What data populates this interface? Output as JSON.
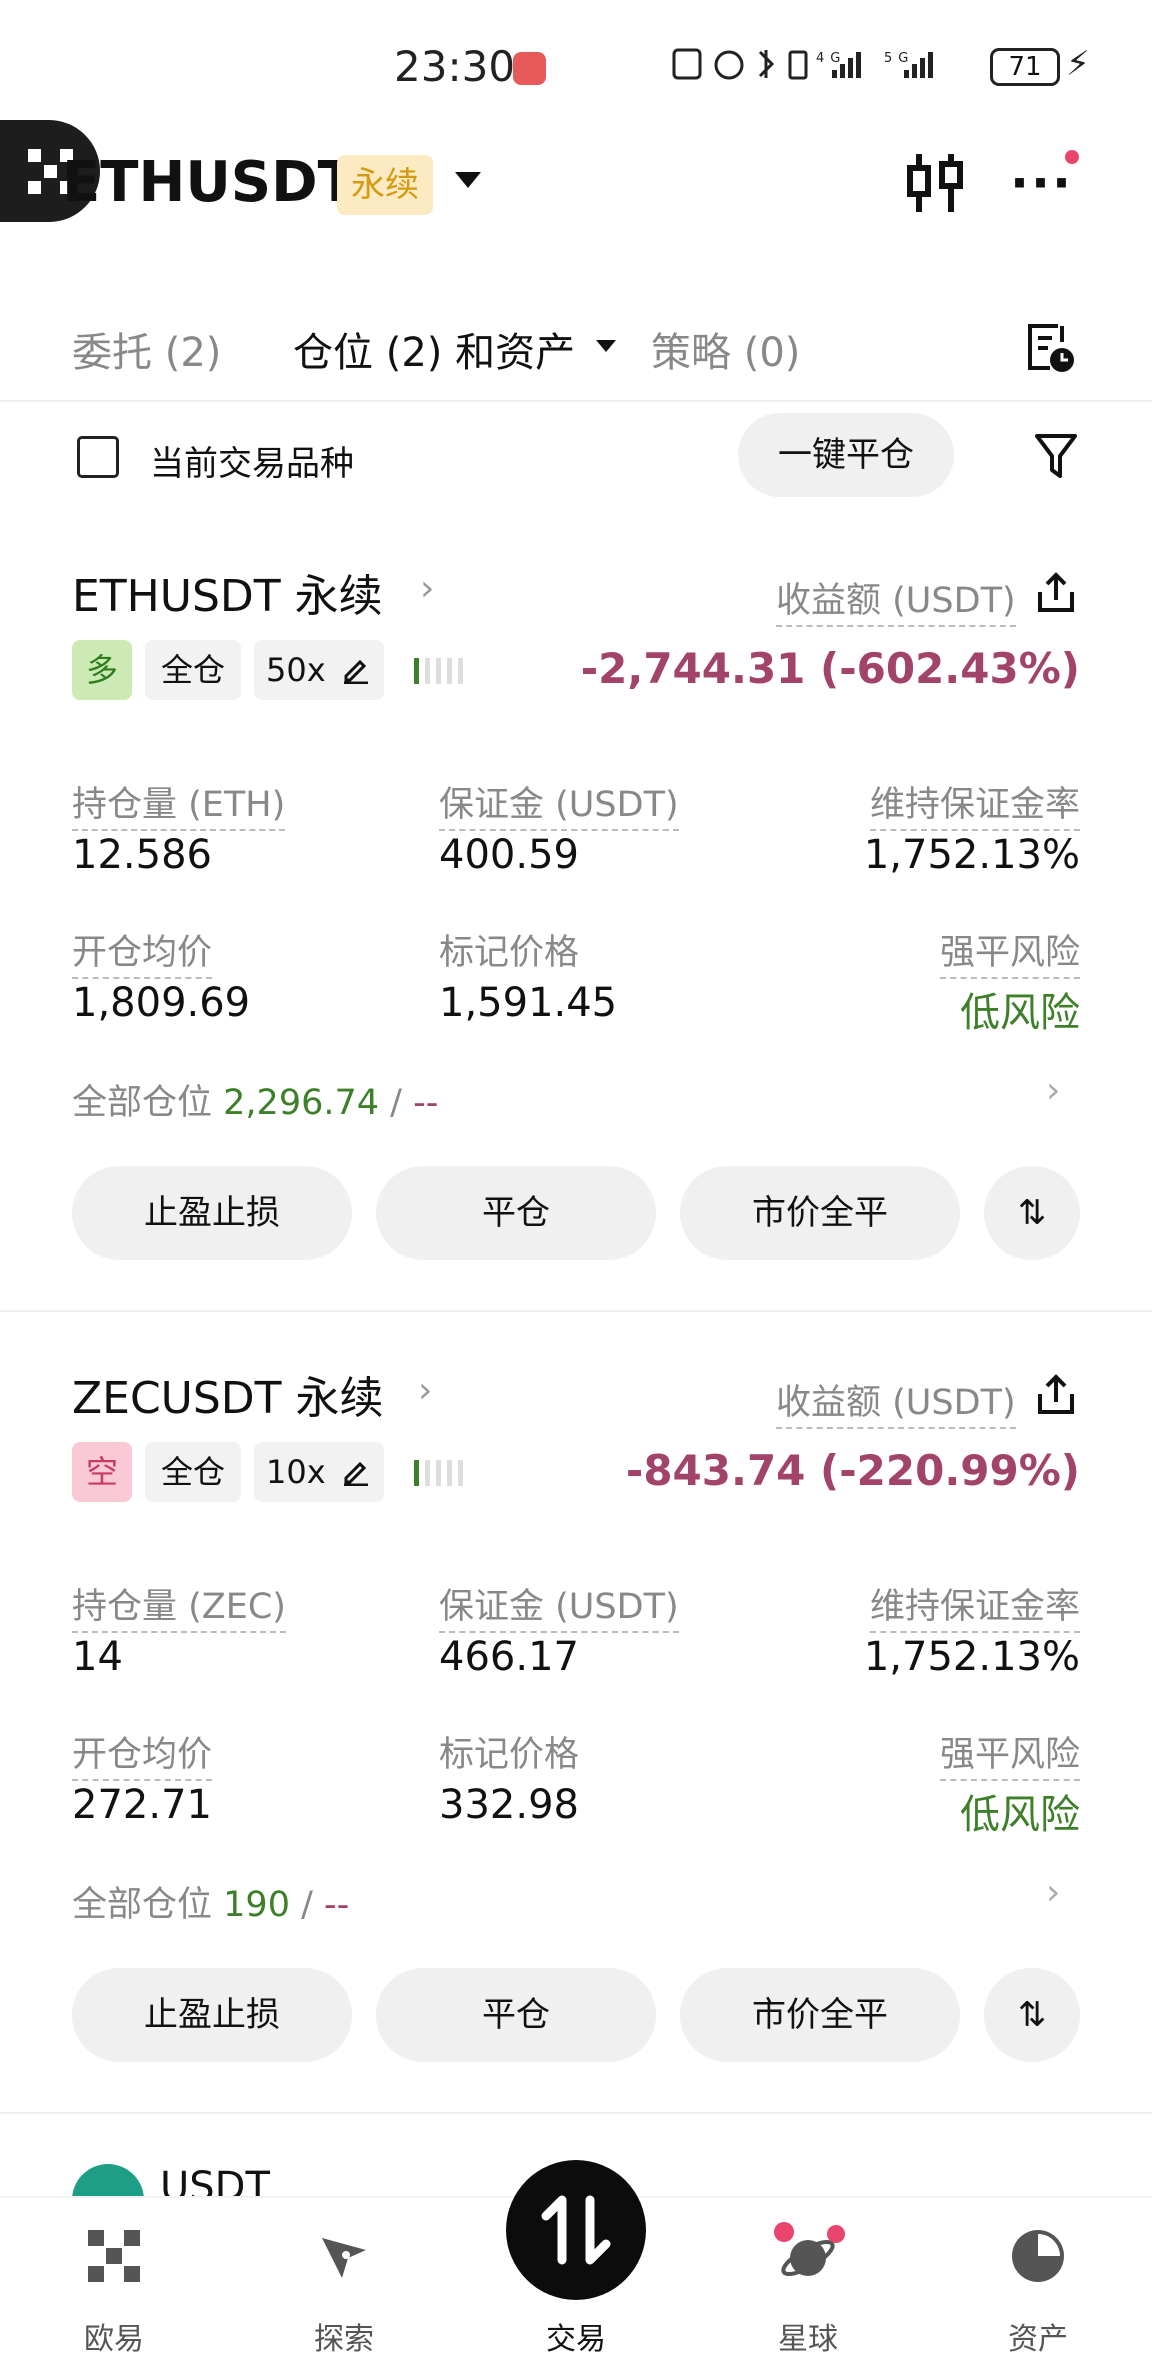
{
  "status_bar": {
    "time": "23:30",
    "battery": "71"
  },
  "header": {
    "pair": "ETHUSDT",
    "contract_type": "永续"
  },
  "tabs": {
    "orders": "委托 (2)",
    "positions": "仓位 (2) 和资产",
    "strategies": "策略 (0)"
  },
  "filter": {
    "current_only_label": "当前交易品种",
    "close_all_label": "一键平仓"
  },
  "positions": [
    {
      "title": "ETHUSDT 永续",
      "side": "多",
      "margin_mode": "全仓",
      "leverage": "50x",
      "pnl_label": "收益额 (USDT)",
      "pnl": "-2,744.31 (-602.43%)",
      "size_label": "持仓量 (ETH)",
      "size": "12.586",
      "margin_label": "保证金 (USDT)",
      "margin": "400.59",
      "mmr_label": "维持保证金率",
      "mmr": "1,752.13%",
      "entry_label": "开仓均价",
      "entry": "1,809.69",
      "mark_label": "标记价格",
      "mark": "1,591.45",
      "risk_label": "强平风险",
      "risk": "低风险",
      "total_label": "全部仓位",
      "total_value": "2,296.74",
      "total_sep": " / ",
      "total_extra": "--",
      "btn_tpsl": "止盈止损",
      "btn_close": "平仓",
      "btn_market_close": "市价全平",
      "btn_reverse": "⇅"
    },
    {
      "title": "ZECUSDT 永续",
      "side": "空",
      "margin_mode": "全仓",
      "leverage": "10x",
      "pnl_label": "收益额 (USDT)",
      "pnl": "-843.74 (-220.99%)",
      "size_label": "持仓量 (ZEC)",
      "size": "14",
      "margin_label": "保证金 (USDT)",
      "margin": "466.17",
      "mmr_label": "维持保证金率",
      "mmr": "1,752.13%",
      "entry_label": "开仓均价",
      "entry": "272.71",
      "mark_label": "标记价格",
      "mark": "332.98",
      "risk_label": "强平风险",
      "risk": "低风险",
      "total_label": "全部仓位",
      "total_value": "190",
      "total_sep": " / ",
      "total_extra": "--",
      "btn_tpsl": "止盈止损",
      "btn_close": "平仓",
      "btn_market_close": "市价全平",
      "btn_reverse": "⇅"
    }
  ],
  "partial_asset": "USDT",
  "bottom_nav": [
    "欧易",
    "探索",
    "交易",
    "星球",
    "资产"
  ],
  "colors": {
    "loss": "#a2436a",
    "gain": "#3e7f2a",
    "long_bg": "#cdeab4",
    "short_bg": "#f9c9d6",
    "perp_tag_bg": "#fbeac2"
  }
}
